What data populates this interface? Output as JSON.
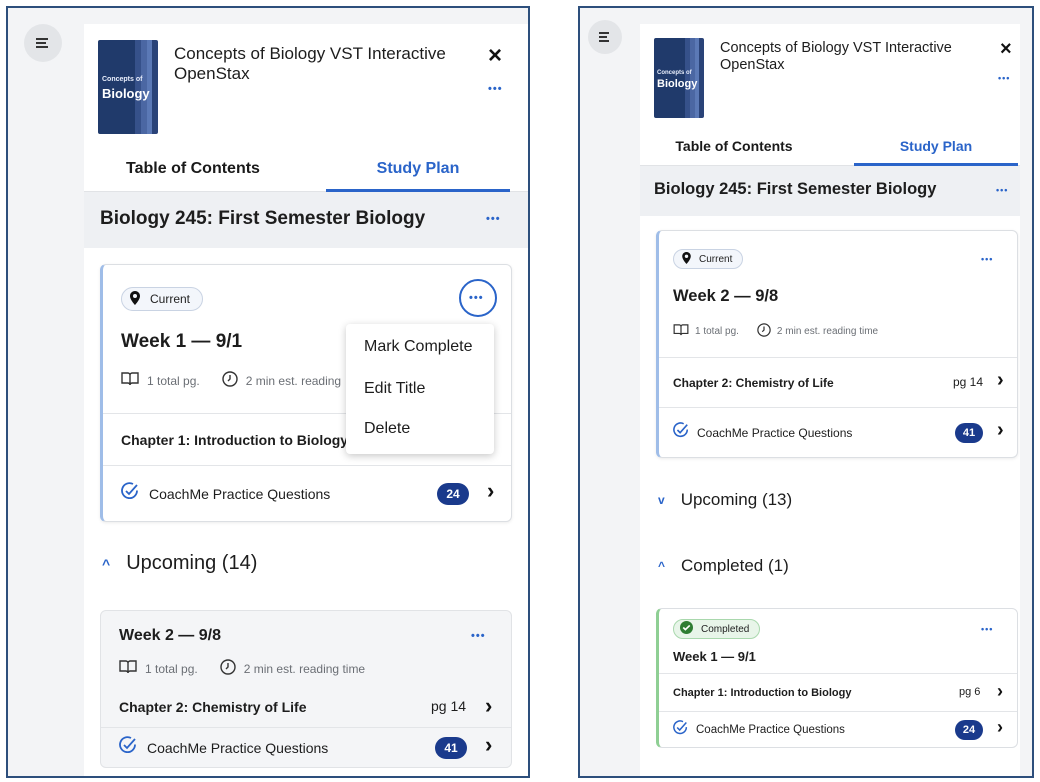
{
  "left": {
    "book": {
      "cover_small": "Concepts of",
      "cover_big": "Biology",
      "title_line1": "Concepts of Biology VST Interactive",
      "title_line2": "OpenStax",
      "close": "×",
      "more": "•••"
    },
    "tabs": {
      "toc": "Table of Contents",
      "study_plan": "Study Plan"
    },
    "plan_title": "Biology 245: First Semester Biology",
    "plan_more": "•••",
    "current_card": {
      "badge": "Current",
      "more": "•••",
      "week": "Week 1 — 9/1",
      "pages": "1 total pg.",
      "reading_time": "2 min est. reading",
      "chapter": "Chapter 1: Introduction to Biology",
      "coachme": "CoachMe Practice Questions",
      "coachme_count": "24",
      "chevron": "›"
    },
    "menu": {
      "items": [
        "Mark Complete",
        "Edit Title",
        "Delete"
      ]
    },
    "upcoming": {
      "caret": "^",
      "label": "Upcoming (14)",
      "card": {
        "week": "Week 2 — 9/8",
        "more": "•••",
        "pages": "1 total pg.",
        "reading_time": "2 min est. reading time",
        "chapter": "Chapter 2: Chemistry of Life",
        "chapter_page": "pg 14",
        "coachme": "CoachMe Practice Questions",
        "coachme_count": "41",
        "chevron": "›"
      }
    }
  },
  "right": {
    "book": {
      "cover_small": "Concepts of",
      "cover_big": "Biology",
      "title_line1": "Concepts of Biology VST Interactive",
      "title_line2": "OpenStax",
      "close": "×",
      "more": "•••"
    },
    "tabs": {
      "toc": "Table of Contents",
      "study_plan": "Study Plan"
    },
    "plan_title": "Biology 245: First Semester Biology",
    "plan_more": "•••",
    "current_card": {
      "badge": "Current",
      "more": "•••",
      "week": "Week 2 — 9/8",
      "pages": "1 total pg.",
      "reading_time": "2 min est. reading time",
      "chapter": "Chapter 2: Chemistry of Life",
      "chapter_page": "pg 14",
      "coachme": "CoachMe Practice Questions",
      "coachme_count": "41",
      "chevron": "›"
    },
    "upcoming": {
      "caret": "v",
      "label": "Upcoming (13)"
    },
    "completed": {
      "caret": "^",
      "label": "Completed (1)",
      "card": {
        "badge": "Completed",
        "more": "•••",
        "week": "Week 1 — 9/1",
        "chapter": "Chapter 1: Introduction to Biology",
        "chapter_page": "pg 6",
        "coachme": "CoachMe Practice Questions",
        "coachme_count": "24",
        "chevron": "›"
      }
    }
  },
  "colors": {
    "accent": "#2a64c9",
    "badge_bg": "#1a3a8c",
    "frame_border": "#2d4f7c",
    "current_border": "#9fbde8",
    "completed_border": "#8fcf94"
  },
  "icons": [
    "menu-icon",
    "map-pin-icon",
    "book-icon",
    "clock-icon",
    "check-circle-icon",
    "check-icon",
    "chevron-right-icon",
    "close-icon",
    "more-icon"
  ]
}
